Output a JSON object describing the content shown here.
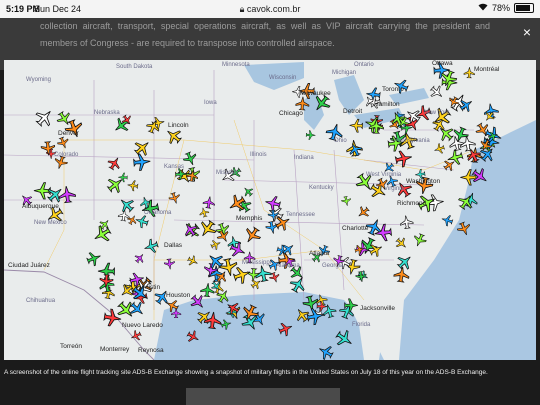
{
  "status": {
    "time": "5:19 PM",
    "date": "Sun Dec 24",
    "url": "cavok.com.br",
    "battery": "78%",
    "battery_level": 0.78
  },
  "article": {
    "text": "collection aircraft, transport, special operations aircraft, as well as VIP aircraft carrying the president and members of Congress - are required to transpose into controlled airspace."
  },
  "lightbox": {
    "close_label": "×",
    "caption": "A screenshot of the online flight tracking site ADS-B Exchange showing a snapshot of military flights in the United States on July 18 of this year on the ADS-B Exchange."
  },
  "map": {
    "labels": {
      "wyoming": "Wyoming",
      "south_dakota": "South Dakota",
      "minnesota": "Minnesota",
      "wisconsin": "Wisconsin",
      "michigan": "Michigan",
      "ontario": "Ontario",
      "ottawa": "Ottawa",
      "montreal": "Montréal",
      "toronto": "Toronto",
      "hamilton": "Hamilton",
      "milwaukee": "Milwaukee",
      "chicago": "Chicago",
      "detroit": "Detroit",
      "new_york": "New York",
      "nebraska": "Nebraska",
      "lincoln": "Lincoln",
      "iowa": "Iowa",
      "illinois": "Illinois",
      "indiana": "Indiana",
      "ohio": "Ohio",
      "pennsylvania": "Pennsylvania",
      "denver": "Denver",
      "colorado": "Colorado",
      "kansas": "Kansas",
      "missouri": "Missouri",
      "kentucky": "Kentucky",
      "west_virginia": "West Virginia",
      "virginia": "Virginia",
      "washington": "Washington",
      "richmond": "Richmond",
      "albuquerque": "Albuquerque",
      "new_mexico": "New Mexico",
      "oklahoma": "Oklahoma",
      "memphis": "Memphis",
      "tennessee": "Tennessee",
      "charlotte": "Charlotte",
      "dallas": "Dallas",
      "atlanta": "Atlanta",
      "georgia": "Georgia",
      "alabama": "Alabama",
      "mississippi": "Mississippi",
      "ciudad_juarez": "Ciudad Juárez",
      "austin": "Austin",
      "houston": "Houston",
      "chihuahua": "Chihuahua",
      "nuevo_laredo": "Nuevo Laredo",
      "torreon": "Torreón",
      "monterrey": "Monterrey",
      "reynosa": "Reynosa",
      "jacksonville": "Jacksonville",
      "florida": "Florida"
    }
  }
}
